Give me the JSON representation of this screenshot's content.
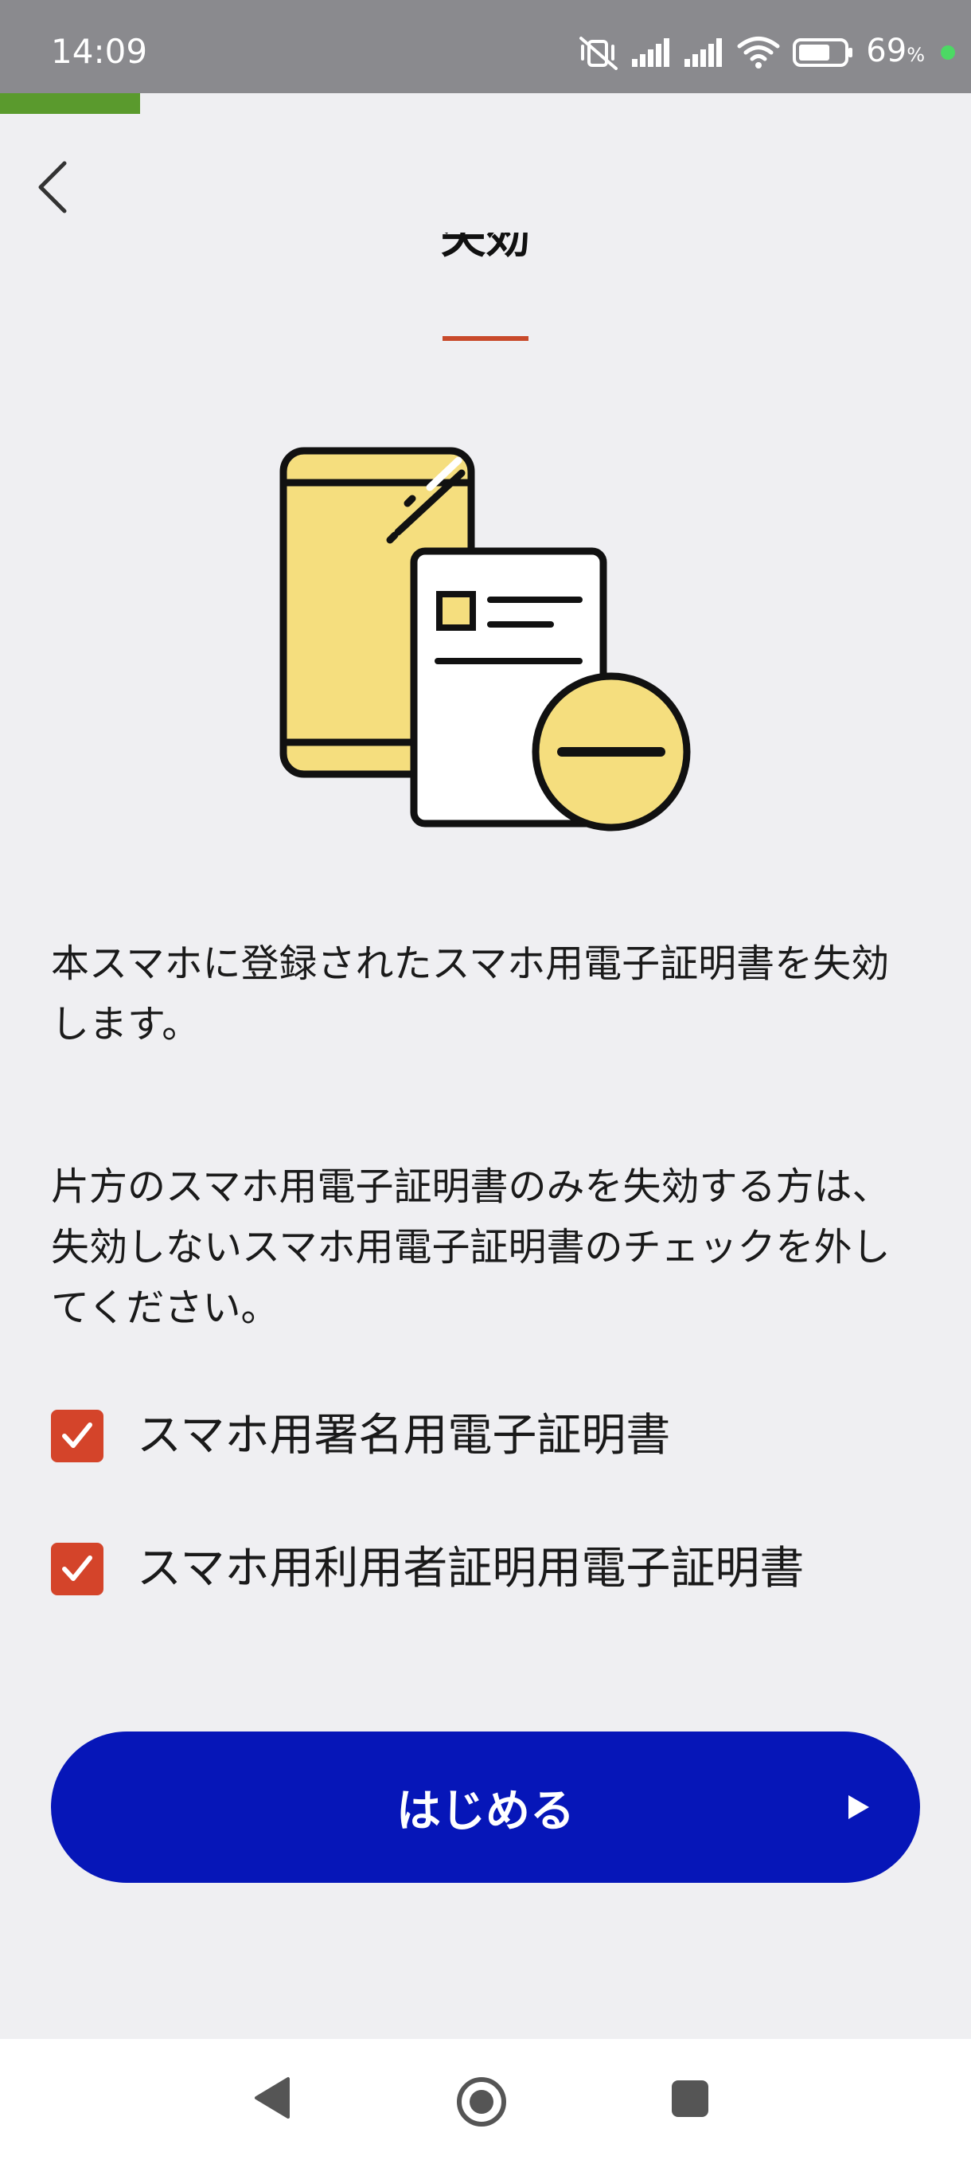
{
  "status_bar": {
    "time": "14:09",
    "battery_percent": "69",
    "battery_unit": "%",
    "icons": [
      "mute-vibrate-icon",
      "signal-icon",
      "signal-icon",
      "wifi-icon",
      "battery-icon"
    ]
  },
  "progress": {
    "fraction": 0.144,
    "color": "#5a9a2d"
  },
  "header": {
    "back_icon": "chevron-left-icon",
    "title": "失効"
  },
  "illustration": {
    "icon": "phone-certificate-revoke-icon"
  },
  "content": {
    "description_1": "本スマホに登録されたスマホ用電子証明書を失効します。",
    "description_2": "片方のスマホ用電子証明書のみを失効する方は、失効しないスマホ用電子証明書のチェックを外してください。"
  },
  "checkboxes": [
    {
      "label": "スマホ用署名用電子証明書",
      "checked": true
    },
    {
      "label": "スマホ用利用者証明用電子証明書",
      "checked": true
    }
  ],
  "action": {
    "start_label": "はじめる",
    "start_icon": "play-icon"
  },
  "nav_bar": {
    "icons": [
      "back-triangle-icon",
      "home-circle-icon",
      "recent-square-icon"
    ]
  },
  "colors": {
    "accent_red": "#d4442a",
    "primary_blue": "#0616b8",
    "illustration_yellow": "#f5de7e"
  }
}
